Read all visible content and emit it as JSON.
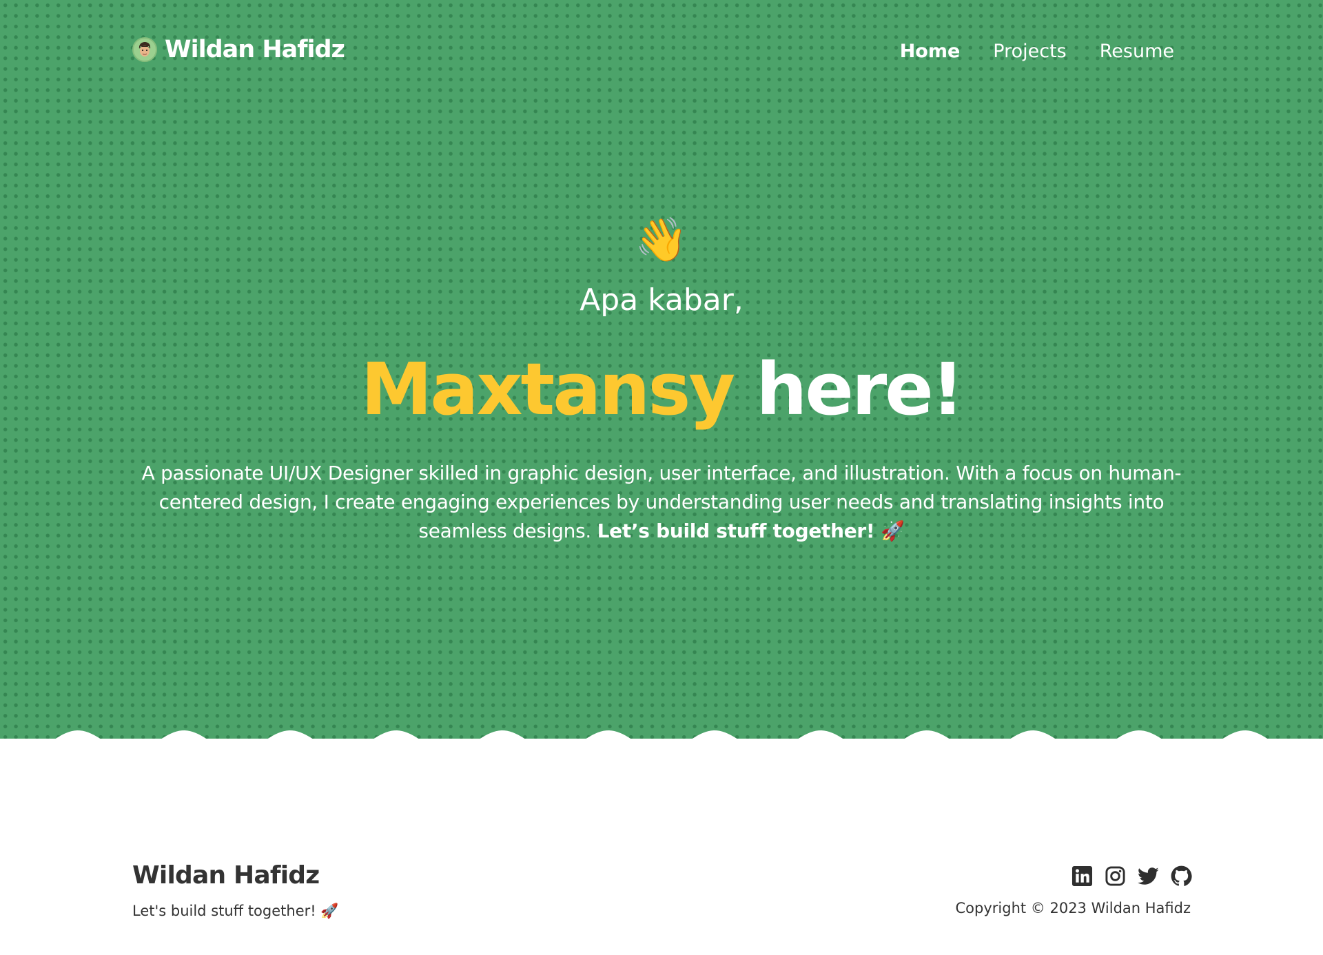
{
  "header": {
    "brand_name": "Wildan Hafidz",
    "nav": [
      {
        "label": "Home",
        "active": true
      },
      {
        "label": "Projects",
        "active": false
      },
      {
        "label": "Resume",
        "active": false
      }
    ]
  },
  "hero": {
    "wave_emoji": "👋",
    "greeting": "Apa kabar,",
    "headline_name": "Maxtansy",
    "headline_rest": "here!",
    "intro_text": "A passionate UI/UX Designer skilled in graphic design, user interface, and illustration. With a focus on human-centered design, I create engaging experiences by understanding user needs and translating insights into seamless designs.",
    "intro_cta": "Let’s build stuff together!",
    "intro_emoji": "🚀"
  },
  "footer": {
    "name": "Wildan Hafidz",
    "tagline": "Let's build stuff together! 🚀",
    "copyright": "Copyright © 2023 Wildan Hafidz",
    "social_icons": [
      "linkedin-icon",
      "instagram-icon",
      "twitter-icon",
      "github-icon"
    ]
  },
  "colors": {
    "hero_green": "#4ca36a",
    "dot_pattern": "#2d7a4a",
    "accent_yellow": "#fdc830",
    "footer_text": "#333333"
  }
}
